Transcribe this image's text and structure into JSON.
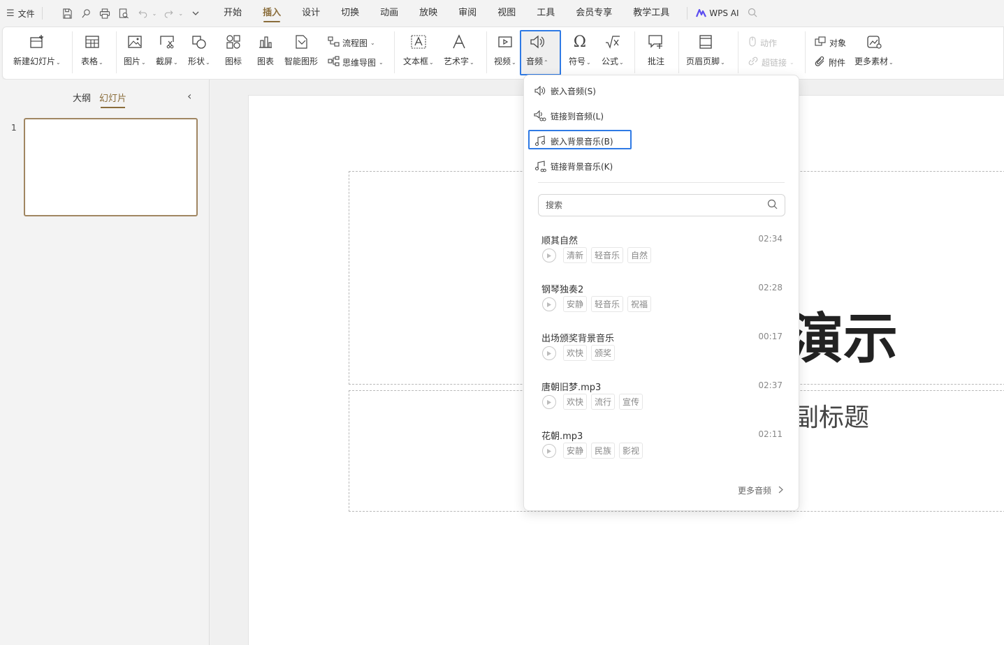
{
  "colors": {
    "accent": "#8a6d3b",
    "highlight": "#2f7ae5"
  },
  "titlebar": {
    "file_label": "文件",
    "tabs": [
      "开始",
      "插入",
      "设计",
      "切换",
      "动画",
      "放映",
      "审阅",
      "视图",
      "工具",
      "会员专享",
      "教学工具"
    ],
    "active_tab": "插入",
    "wps_ai_label": "WPS AI"
  },
  "ribbon": {
    "new_slide": "新建幻灯片",
    "table": "表格",
    "picture": "图片",
    "screenshot": "截屏",
    "shape": "形状",
    "icon": "图标",
    "chart": "图表",
    "smart_graphic": "智能图形",
    "flowchart": "流程图",
    "mindmap": "思维导图",
    "textbox": "文本框",
    "wordart": "艺术字",
    "video": "视频",
    "audio": "音频",
    "symbol": "符号",
    "formula": "公式",
    "comment": "批注",
    "header_footer": "页眉页脚",
    "action": "动作",
    "hyperlink": "超链接",
    "object": "对象",
    "attachment": "附件",
    "more_material": "更多素材"
  },
  "left_panel": {
    "tab_outline": "大纲",
    "tab_slides": "幻灯片",
    "slide_number": "1"
  },
  "slide": {
    "title_fragment": "演示",
    "subtitle_fragment": "副标题"
  },
  "audio_menu": {
    "embed_audio": "嵌入音频(S)",
    "link_audio": "链接到音频(L)",
    "embed_bg_music": "嵌入背景音乐(B)",
    "link_bg_music": "链接背景音乐(K)",
    "search_placeholder": "搜索",
    "more_audio": "更多音频",
    "tracks": [
      {
        "name": "顺其自然",
        "duration": "02:34",
        "tags": [
          "清新",
          "轻音乐",
          "自然"
        ]
      },
      {
        "name": "钢琴独奏2",
        "duration": "02:28",
        "tags": [
          "安静",
          "轻音乐",
          "祝福"
        ]
      },
      {
        "name": "出场颁奖背景音乐",
        "duration": "00:17",
        "tags": [
          "欢快",
          "颁奖"
        ]
      },
      {
        "name": "唐朝旧梦.mp3",
        "duration": "02:37",
        "tags": [
          "欢快",
          "流行",
          "宣传"
        ]
      },
      {
        "name": "花朝.mp3",
        "duration": "02:11",
        "tags": [
          "安静",
          "民族",
          "影视"
        ]
      }
    ]
  }
}
